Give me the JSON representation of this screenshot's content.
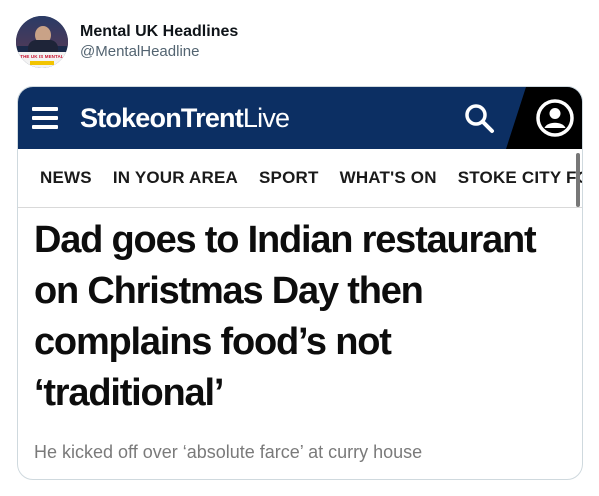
{
  "tweet": {
    "display_name": "Mental UK Headlines",
    "handle": "@MentalHeadline",
    "avatar_text": "THE UK IS MENTAL"
  },
  "site": {
    "logo_bold": "StokeonTrent",
    "logo_light": "Live",
    "brand_color": "#0c2f63",
    "nav_items": [
      "NEWS",
      "IN YOUR AREA",
      "SPORT",
      "WHAT'S ON",
      "STOKE CITY FC"
    ]
  },
  "article": {
    "headline": "Dad goes to Indian restaurant on Christmas Day then complains food’s not ‘traditional’",
    "subhead": "He kicked off over ‘absolute farce’ at curry house"
  },
  "icons": {
    "menu": "hamburger-icon",
    "search": "search-icon",
    "account": "account-icon"
  }
}
